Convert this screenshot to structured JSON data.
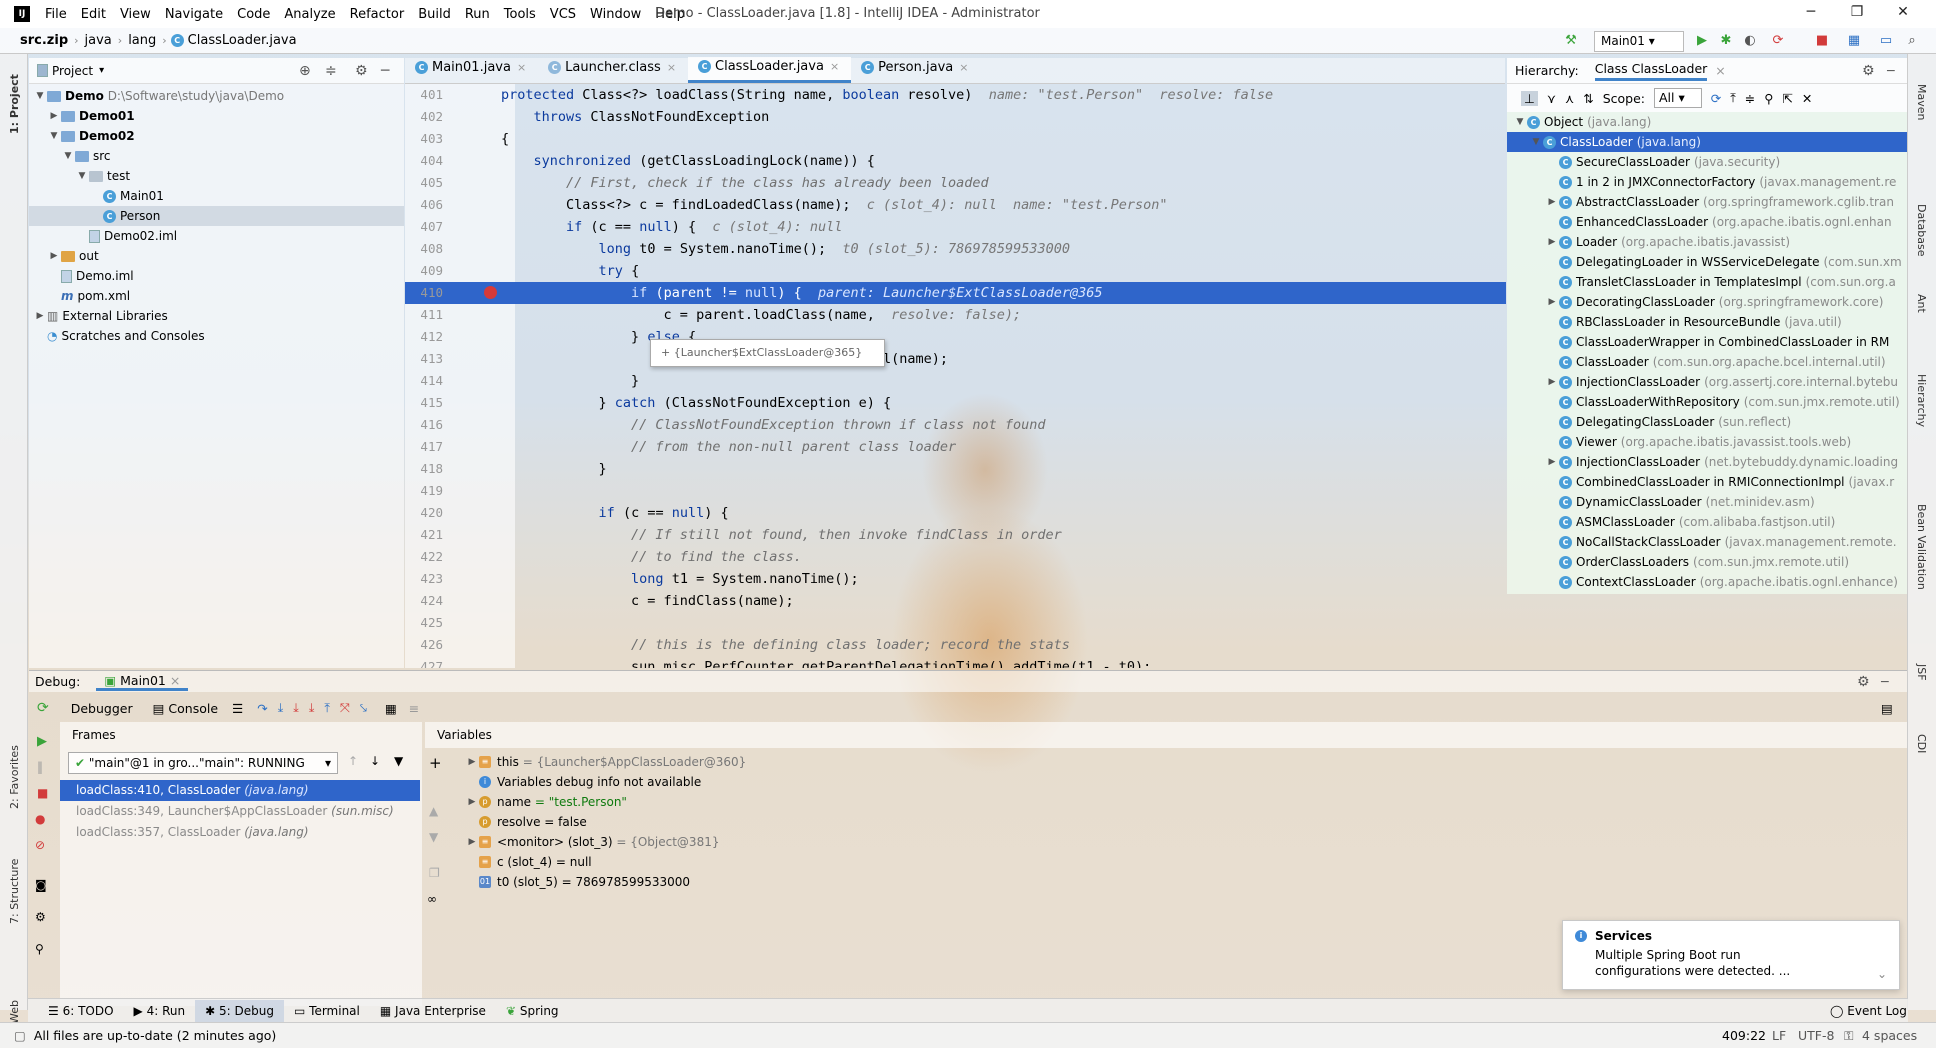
{
  "window": {
    "title": "Demo - ClassLoader.java [1.8] - IntelliJ IDEA - Administrator",
    "menu": [
      "File",
      "Edit",
      "View",
      "Navigate",
      "Code",
      "Analyze",
      "Refactor",
      "Build",
      "Run",
      "Tools",
      "VCS",
      "Window",
      "Help"
    ]
  },
  "breadcrumb": [
    "src.zip",
    "java",
    "lang",
    "ClassLoader.java"
  ],
  "toolbar": {
    "run_config": "Main01"
  },
  "left_stripe": {
    "project": "1: Project",
    "favorites": "2: Favorites",
    "structure": "7: Structure",
    "web": "Web"
  },
  "right_stripe": [
    "Maven",
    "Database",
    "Ant",
    "Hierarchy",
    "Bean Validation",
    "JSF",
    "CDI"
  ],
  "project": {
    "header": "Project",
    "tree": [
      {
        "label": "Demo",
        "extra": "D:\\Software\\study\\java\\Demo",
        "bold": true
      },
      {
        "label": "Demo01",
        "bold": true
      },
      {
        "label": "Demo02",
        "bold": true
      },
      {
        "label": "src"
      },
      {
        "label": "test"
      },
      {
        "label": "Main01"
      },
      {
        "label": "Person"
      },
      {
        "label": "Demo02.iml"
      },
      {
        "label": "out"
      },
      {
        "label": "Demo.iml"
      },
      {
        "label": "pom.xml"
      },
      {
        "label": "External Libraries"
      },
      {
        "label": "Scratches and Consoles"
      }
    ]
  },
  "editor": {
    "tabs": [
      "Main01.java",
      "Launcher.class",
      "ClassLoader.java",
      "Person.java"
    ],
    "active_tab": "ClassLoader.java",
    "lines": [
      {
        "n": "401",
        "code": "protected Class<?> loadClass(String name, boolean resolve)",
        "hint": "  name: \"test.Person\"  resolve: false"
      },
      {
        "n": "402",
        "code": "    throws ClassNotFoundException",
        "hint": ""
      },
      {
        "n": "403",
        "code": "{",
        "hint": ""
      },
      {
        "n": "404",
        "code": "    synchronized (getClassLoadingLock(name)) {",
        "hint": ""
      },
      {
        "n": "405",
        "code": "        // First, check if the class has already been loaded",
        "hint": "",
        "comment": true
      },
      {
        "n": "406",
        "code": "        Class<?> c = findLoadedClass(name);",
        "hint": "  c (slot_4): null  name: \"test.Person\""
      },
      {
        "n": "407",
        "code": "        if (c == null) {",
        "hint": "  c (slot_4): null"
      },
      {
        "n": "408",
        "code": "            long t0 = System.nanoTime();",
        "hint": "  t0 (slot_5): 786978599533000"
      },
      {
        "n": "409",
        "code": "            try {",
        "hint": ""
      },
      {
        "n": "410",
        "code": "                if (parent != null) {",
        "hint": "  parent: Launcher$ExtClassLoader@365",
        "highlight": true
      },
      {
        "n": "411",
        "code": "                    c = parent.loadClass(name,",
        "hint": "  resolve: false);"
      },
      {
        "n": "412",
        "code": "                } else {",
        "hint": ""
      },
      {
        "n": "413",
        "code": "                    c = findBootstrapClassOrNull(name);",
        "hint": ""
      },
      {
        "n": "414",
        "code": "                }",
        "hint": ""
      },
      {
        "n": "415",
        "code": "            } catch (ClassNotFoundException e) {",
        "hint": ""
      },
      {
        "n": "416",
        "code": "                // ClassNotFoundException thrown if class not found",
        "hint": "",
        "comment": true
      },
      {
        "n": "417",
        "code": "                // from the non-null parent class loader",
        "hint": "",
        "comment": true
      },
      {
        "n": "418",
        "code": "            }",
        "hint": ""
      },
      {
        "n": "419",
        "code": "",
        "hint": ""
      },
      {
        "n": "420",
        "code": "            if (c == null) {",
        "hint": ""
      },
      {
        "n": "421",
        "code": "                // If still not found, then invoke findClass in order",
        "hint": "",
        "comment": true
      },
      {
        "n": "422",
        "code": "                // to find the class.",
        "hint": "",
        "comment": true
      },
      {
        "n": "423",
        "code": "                long t1 = System.nanoTime();",
        "hint": ""
      },
      {
        "n": "424",
        "code": "                c = findClass(name);",
        "hint": ""
      },
      {
        "n": "425",
        "code": "",
        "hint": ""
      },
      {
        "n": "426",
        "code": "                // this is the defining class loader; record the stats",
        "hint": "",
        "comment": true
      },
      {
        "n": "427",
        "code": "                sun.misc.PerfCounter.getParentDelegationTime().addTime(t1 - t0);",
        "hint": ""
      }
    ],
    "popup": "+ {Launcher$ExtClassLoader@365}"
  },
  "hierarchy": {
    "title": "Hierarchy:",
    "tab": "Class ClassLoader",
    "scope_label": "Scope:",
    "scope_value": "All",
    "rows": [
      {
        "name": "Object",
        "pkg": "(java.lang)"
      },
      {
        "name": "ClassLoader",
        "pkg": "(java.lang)",
        "selected": true
      },
      {
        "name": "SecureClassLoader",
        "pkg": "(java.security)"
      },
      {
        "name": "1 in 2 in JMXConnectorFactory",
        "pkg": "(javax.management.re"
      },
      {
        "name": "AbstractClassLoader",
        "pkg": "(org.springframework.cglib.tran"
      },
      {
        "name": "EnhancedClassLoader",
        "pkg": "(org.apache.ibatis.ognl.enhan"
      },
      {
        "name": "Loader",
        "pkg": "(org.apache.ibatis.javassist)"
      },
      {
        "name": "DelegatingLoader in WSServiceDelegate",
        "pkg": "(com.sun.xm"
      },
      {
        "name": "TransletClassLoader in TemplatesImpl",
        "pkg": "(com.sun.org.a"
      },
      {
        "name": "DecoratingClassLoader",
        "pkg": "(org.springframework.core)"
      },
      {
        "name": "RBClassLoader in ResourceBundle",
        "pkg": "(java.util)"
      },
      {
        "name": "ClassLoaderWrapper in CombinedClassLoader in RM",
        "pkg": ""
      },
      {
        "name": "ClassLoader",
        "pkg": "(com.sun.org.apache.bcel.internal.util)"
      },
      {
        "name": "InjectionClassLoader",
        "pkg": "(org.assertj.core.internal.bytebu"
      },
      {
        "name": "ClassLoaderWithRepository",
        "pkg": "(com.sun.jmx.remote.util)"
      },
      {
        "name": "DelegatingClassLoader",
        "pkg": "(sun.reflect)"
      },
      {
        "name": "Viewer",
        "pkg": "(org.apache.ibatis.javassist.tools.web)"
      },
      {
        "name": "InjectionClassLoader",
        "pkg": "(net.bytebuddy.dynamic.loading"
      },
      {
        "name": "CombinedClassLoader in RMIConnectionImpl",
        "pkg": "(javax.r"
      },
      {
        "name": "DynamicClassLoader",
        "pkg": "(net.minidev.asm)"
      },
      {
        "name": "ASMClassLoader",
        "pkg": "(com.alibaba.fastjson.util)"
      },
      {
        "name": "NoCallStackClassLoader",
        "pkg": "(javax.management.remote."
      },
      {
        "name": "OrderClassLoaders",
        "pkg": "(com.sun.jmx.remote.util)"
      },
      {
        "name": "ContextClassLoader",
        "pkg": "(org.apache.ibatis.ognl.enhance)"
      }
    ]
  },
  "debug": {
    "label": "Debug:",
    "session": "Main01",
    "tab_debugger": "Debugger",
    "tab_console": "Console",
    "frames_header": "Frames",
    "variables_header": "Variables",
    "thread": "\"main\"@1 in gro...\"main\": RUNNING",
    "frames": [
      {
        "method": "loadClass:410, ClassLoader",
        "loc": "(java.lang)"
      },
      {
        "method": "loadClass:349, Launcher$AppClassLoader",
        "loc": "(sun.misc)"
      },
      {
        "method": "loadClass:357, ClassLoader",
        "loc": "(java.lang)"
      }
    ],
    "variables": [
      {
        "name": "this",
        "value": "= {Launcher$AppClassLoader@360}"
      },
      {
        "name": "Variables debug info not available",
        "value": ""
      },
      {
        "name": "name",
        "value": "= \"test.Person\""
      },
      {
        "name": "resolve",
        "value": "= false"
      },
      {
        "name": "<monitor> (slot_3)",
        "value": "= {Object@381}"
      },
      {
        "name": "c (slot_4)",
        "value": "= null"
      },
      {
        "name": "t0 (slot_5)",
        "value": "= 786978599533000"
      }
    ]
  },
  "services": {
    "title": "Services",
    "message": "Multiple Spring Boot run configurations were detected. ..."
  },
  "bottom_tabs": [
    "6: TODO",
    "4: Run",
    "5: Debug",
    "Terminal",
    "Java Enterprise",
    "Spring"
  ],
  "event_log": "Event Log",
  "status": {
    "message": "All files are up-to-date (2 minutes ago)",
    "position": "409:22",
    "line_sep": "LF",
    "encoding": "UTF-8",
    "indent": "4 spaces"
  }
}
